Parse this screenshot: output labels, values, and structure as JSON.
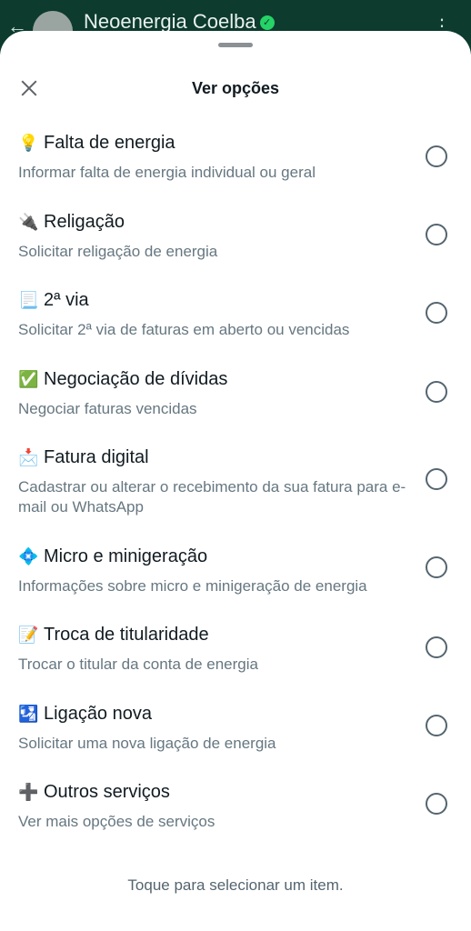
{
  "topbar": {
    "back_icon": "arrow-left-icon",
    "contact_name": "Neoenergia Coelba",
    "verified_icon": "verified-badge-icon",
    "more_icon": "more-vert-icon"
  },
  "sheet": {
    "title": "Ver opções",
    "close_icon": "close-icon",
    "footer": "Toque para selecionar um item."
  },
  "options": [
    {
      "emoji": "💡",
      "label": "Falta de energia",
      "desc": "Informar falta de energia individual ou geral"
    },
    {
      "emoji": "🔌",
      "label": "Religação",
      "desc": "Solicitar religação de energia"
    },
    {
      "emoji": "📃",
      "label": "2ª via",
      "desc": "Solicitar 2ª via de faturas em aberto ou vencidas"
    },
    {
      "emoji": "✅",
      "label": "Negociação de dívidas",
      "desc": "Negociar faturas vencidas"
    },
    {
      "emoji": "📩",
      "label": "Fatura digital",
      "desc": "Cadastrar ou alterar o recebimento da sua fatura para e-mail ou WhatsApp"
    },
    {
      "emoji": "💠",
      "label": "Micro e minigeração",
      "desc": "Informações sobre micro e minigeração de energia"
    },
    {
      "emoji": "📝",
      "label": "Troca de titularidade",
      "desc": "Trocar o titular da conta de energia"
    },
    {
      "emoji": "🛂",
      "label": "Ligação nova",
      "desc": "Solicitar uma nova ligação de energia"
    },
    {
      "emoji": "➕",
      "label": "Outros serviços",
      "desc": "Ver mais opções de serviços"
    }
  ]
}
